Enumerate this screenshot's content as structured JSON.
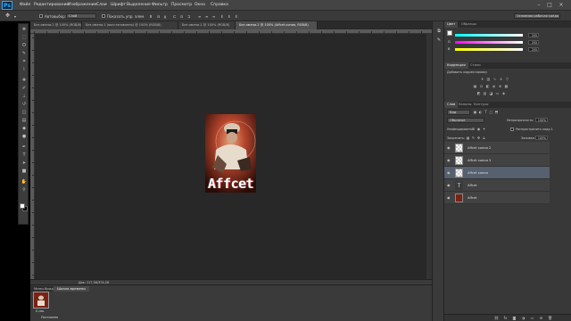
{
  "menubar": {
    "logo": "Ps",
    "items": [
      "Файл",
      "Редактирование",
      "Изображение",
      "Слои",
      "Шрифт",
      "Выделение",
      "Фильтр",
      "Просмотр",
      "Окно",
      "Справка"
    ]
  },
  "options": {
    "autoselect_label": "Автовыбор:",
    "autoselect_value": "Слой",
    "transform_label": "Показать упр. элем.",
    "workspace": "Основная рабочая среда"
  },
  "tools": {
    "icons": [
      "move-icon",
      "marquee-icon",
      "lasso-icon",
      "quick-select-icon",
      "crop-icon",
      "eyedropper-icon",
      "healing-icon",
      "brush-icon",
      "stamp-icon",
      "history-brush-icon",
      "eraser-icon",
      "gradient-icon",
      "blur-icon",
      "dodge-icon",
      "pen-icon",
      "type-icon",
      "path-select-icon",
      "shape-icon",
      "hand-icon",
      "zoom-icon"
    ]
  },
  "document": {
    "tabs": [
      "Без имени-1 @ 100% (RGB/8)",
      "Без имени-1 (восстановлено) @ 100% (RGB/8)",
      "Без имени-1 @ 100% (RGB/8)",
      "Без имени-2 @ 100% (Affcet копия, RGB/8)"
    ],
    "art_text": "Affcet",
    "status": "Док: 117,3К/374,2К"
  },
  "color_panel": {
    "tabs": [
      "Цвет",
      "Образцы"
    ],
    "channels": [
      {
        "label": "R",
        "value": "255"
      },
      {
        "label": "G",
        "value": "255"
      },
      {
        "label": "B",
        "value": "255"
      }
    ]
  },
  "adjustments_panel": {
    "tabs": [
      "Коррекция",
      "Стили"
    ],
    "title": "Добавить корректировку"
  },
  "layers_panel": {
    "tabs": [
      "Слои",
      "Каналы",
      "Контуры"
    ],
    "kind_filter": "Вид",
    "blend_mode": "Обычные",
    "opacity_label": "Непрозрачность:",
    "opacity_value": "100%",
    "unify_label": "Унифицировать:",
    "propagate_label": "Распространить кадр 1",
    "lock_label": "Закрепить:",
    "fill_label": "Заливка:",
    "fill_value": "100%",
    "layers": [
      {
        "name": "Affcet копия 2",
        "kind": "checker",
        "selected": false
      },
      {
        "name": "Affcet копия 3",
        "kind": "checker",
        "selected": false
      },
      {
        "name": "Affcet копия",
        "kind": "checker",
        "selected": true
      },
      {
        "name": "Affcet",
        "kind": "text",
        "selected": false
      },
      {
        "name": "Affcet",
        "kind": "photo",
        "selected": false
      }
    ]
  },
  "timeline": {
    "tabs": [
      "Мини-бридж",
      "Шкала времени"
    ],
    "frame_time": "0 сек.",
    "loop_mode": "Постоянно"
  },
  "colors": {
    "accent": "#31a8ff",
    "selected_layer": "#56606e",
    "canvas_bg": "#282828"
  }
}
